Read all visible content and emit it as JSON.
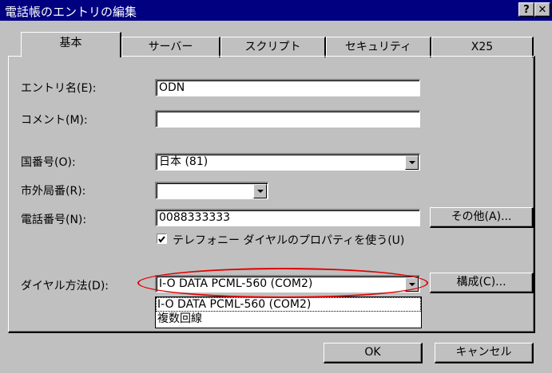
{
  "window": {
    "title": "電話帳のエントリの編集",
    "help_button": "?",
    "close_button": "✕"
  },
  "tabs": [
    "基本",
    "サーバー",
    "スクリプト",
    "セキュリティ",
    "X25"
  ],
  "form": {
    "entry_name_label": "エントリ名(E):",
    "entry_name_value": "ODN",
    "comment_label": "コメント(M):",
    "comment_value": "",
    "country_label": "国番号(O):",
    "country_value": "日本 (81)",
    "area_label": "市外局番(R):",
    "area_value": "",
    "phone_label": "電話番号(N):",
    "phone_value": "0088333333",
    "other_button": "その他(A)...",
    "telephony_checkbox_label": "テレフォニー ダイヤルのプロパティを使う(U)",
    "telephony_checked": true,
    "dial_label": "ダイヤル方法(D):",
    "dial_value": "I-O DATA PCML-560 (COM2)",
    "configure_button": "構成(C)...",
    "dial_options": [
      "I-O DATA PCML-560 (COM2)",
      "複数回線"
    ]
  },
  "buttons": {
    "ok": "OK",
    "cancel": "キャンセル"
  },
  "colors": {
    "titlebar": "#000080",
    "face": "#c0c0c0",
    "highlight": "#e00000"
  }
}
